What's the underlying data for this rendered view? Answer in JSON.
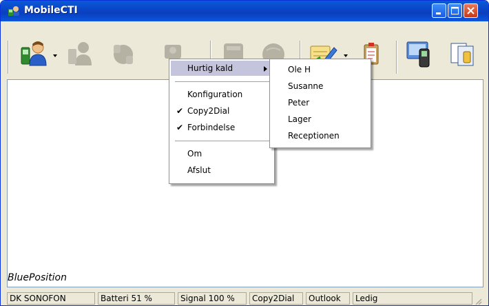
{
  "window": {
    "title": "MobileCTI",
    "accent": "#0a46c8"
  },
  "toolbar": {
    "tools": [
      {
        "icon": "contacts-phone-icon",
        "enabled": true
      },
      {
        "icon": "users-icon",
        "enabled": false
      },
      {
        "icon": "phone-handset-icon",
        "enabled": false
      },
      {
        "icon": "contact-card-icon",
        "enabled": false
      },
      {
        "icon": "keypad-icon",
        "enabled": false
      },
      {
        "icon": "globe-icon",
        "enabled": false
      },
      {
        "icon": "notepad-icon",
        "enabled": true
      },
      {
        "icon": "clipboard-icon",
        "enabled": true
      },
      {
        "icon": "mobile-computer-icon",
        "enabled": true
      },
      {
        "icon": "copy-pages-icon",
        "enabled": true
      }
    ]
  },
  "context_menu": {
    "items": [
      {
        "label": "Hurtig kald",
        "checked": false,
        "has_submenu": true,
        "highlighted": true
      },
      {
        "label": "Konfiguration",
        "checked": false
      },
      {
        "label": "Copy2Dial",
        "checked": true
      },
      {
        "label": "Forbindelse",
        "checked": true
      },
      {
        "label": "Om",
        "checked": false
      },
      {
        "label": "Afslut",
        "checked": false
      }
    ]
  },
  "submenu": {
    "items": [
      "Ole H",
      "Susanne",
      "Peter",
      "Lager",
      "Receptionen"
    ]
  },
  "content": {
    "brand": "BluePosition"
  },
  "statusbar": {
    "operator": "DK SONOFON",
    "battery": "Batteri 51 %",
    "signal": "Signal 100 %",
    "copy2dial": "Copy2Dial",
    "outlook": "Outlook",
    "state": "Ledig"
  }
}
